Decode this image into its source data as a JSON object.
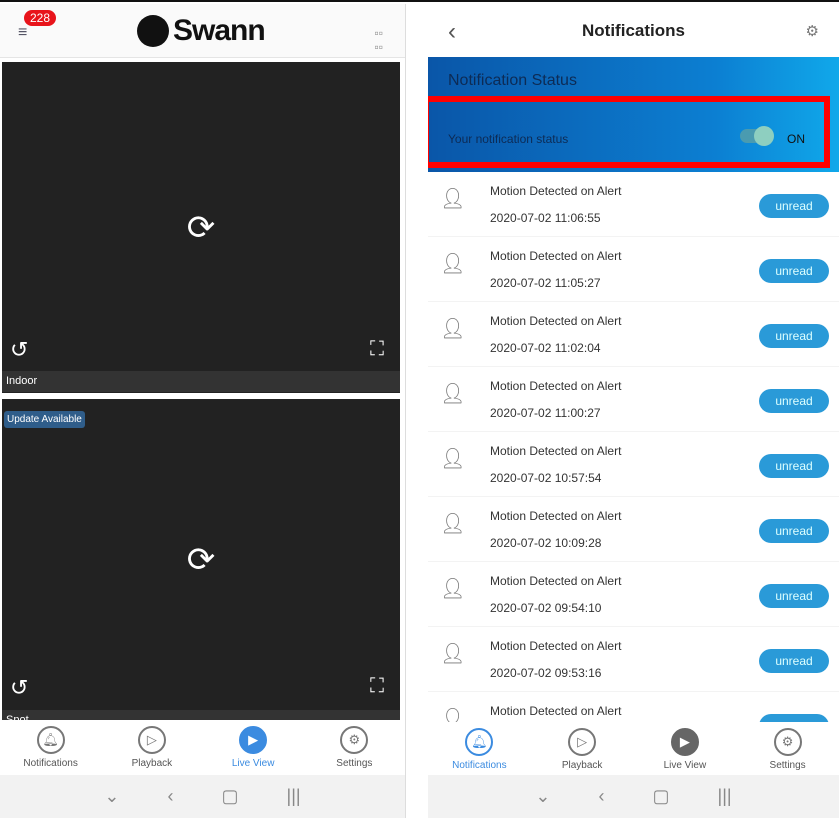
{
  "left": {
    "badge_count": "228",
    "logo": "Swann",
    "cameras": [
      {
        "label": "Indoor"
      },
      {
        "label": "Spot",
        "update_badge": "Update Available"
      }
    ],
    "nav": [
      {
        "label": "Notifications"
      },
      {
        "label": "Playback"
      },
      {
        "label": "Live View",
        "active": true
      },
      {
        "label": "Settings"
      }
    ]
  },
  "right": {
    "title": "Notifications",
    "status_heading": "Notification Status",
    "status_label": "Your notification status",
    "status_value": "ON",
    "status_on": true,
    "items": [
      {
        "title": "Motion Detected on Alert",
        "time": "2020-07-02 11:06:55",
        "status": "unread"
      },
      {
        "title": "Motion Detected on Alert",
        "time": "2020-07-02 11:05:27",
        "status": "unread"
      },
      {
        "title": "Motion Detected on Alert",
        "time": "2020-07-02 11:02:04",
        "status": "unread"
      },
      {
        "title": "Motion Detected on Alert",
        "time": "2020-07-02 11:00:27",
        "status": "unread"
      },
      {
        "title": "Motion Detected on Alert",
        "time": "2020-07-02 10:57:54",
        "status": "unread"
      },
      {
        "title": "Motion Detected on Alert",
        "time": "2020-07-02 10:09:28",
        "status": "unread"
      },
      {
        "title": "Motion Detected on Alert",
        "time": "2020-07-02 09:54:10",
        "status": "unread"
      },
      {
        "title": "Motion Detected on Alert",
        "time": "2020-07-02 09:53:16",
        "status": "unread"
      },
      {
        "title": "Motion Detected on Alert",
        "time": "",
        "status": ""
      }
    ],
    "nav": [
      {
        "label": "Notifications",
        "active": true
      },
      {
        "label": "Playback"
      },
      {
        "label": "Live View"
      },
      {
        "label": "Settings"
      }
    ]
  },
  "colors": {
    "accent": "#3b8be0",
    "highlight": "#ff0000",
    "unread": "#2a9ad8",
    "badge": "#e8141b"
  }
}
